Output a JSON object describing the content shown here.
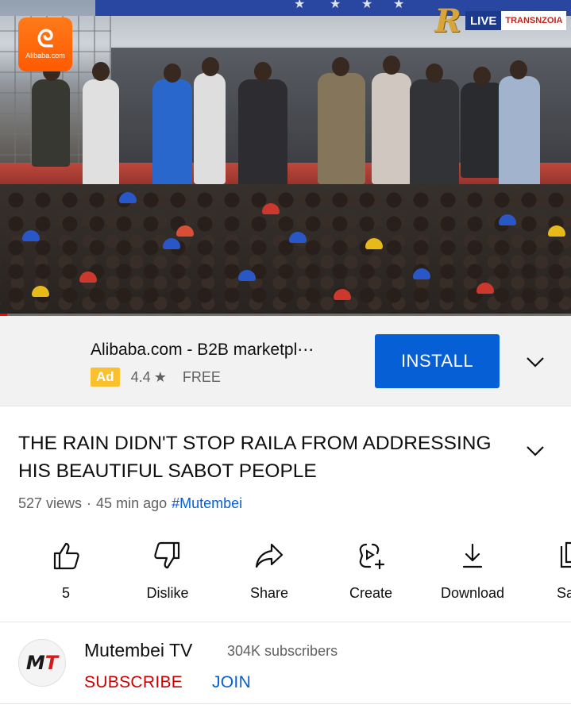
{
  "video": {
    "live_label": "LIVE",
    "region_label": "TRANSNZOIA",
    "logo_letter": "R",
    "progress_fraction": 0.012
  },
  "ad": {
    "logo_glyph": "ᘓ",
    "logo_text": "Alibaba.com",
    "title": "Alibaba.com - B2B marketpl⋯",
    "badge": "Ad",
    "rating": "4.4",
    "price": "FREE",
    "install_label": "INSTALL"
  },
  "video_info": {
    "title": "THE RAIN DIDN'T STOP RAILA FROM ADDRESSING HIS BEAUTIFUL SABOT PEOPLE",
    "views": "527 views",
    "separator": "·",
    "age": "45 min ago",
    "hashtag": "#Mutembei"
  },
  "actions": [
    {
      "label": "5",
      "icon": "thumbs-up-icon"
    },
    {
      "label": "Dislike",
      "icon": "thumbs-down-icon"
    },
    {
      "label": "Share",
      "icon": "share-icon"
    },
    {
      "label": "Create",
      "icon": "create-icon"
    },
    {
      "label": "Download",
      "icon": "download-icon"
    },
    {
      "label": "Sa",
      "icon": "save-icon"
    }
  ],
  "channel": {
    "avatar_m": "M",
    "avatar_t": "T",
    "name": "Mutembei TV",
    "subscribers": "304K subscribers",
    "subscribe_label": "SUBSCRIBE",
    "join_label": "JOIN"
  },
  "colors": {
    "accent_blue": "#065fd4",
    "subscribe_red": "#cc0000",
    "ad_badge": "#fbc02d",
    "alibaba_orange": "#ff6a00"
  }
}
